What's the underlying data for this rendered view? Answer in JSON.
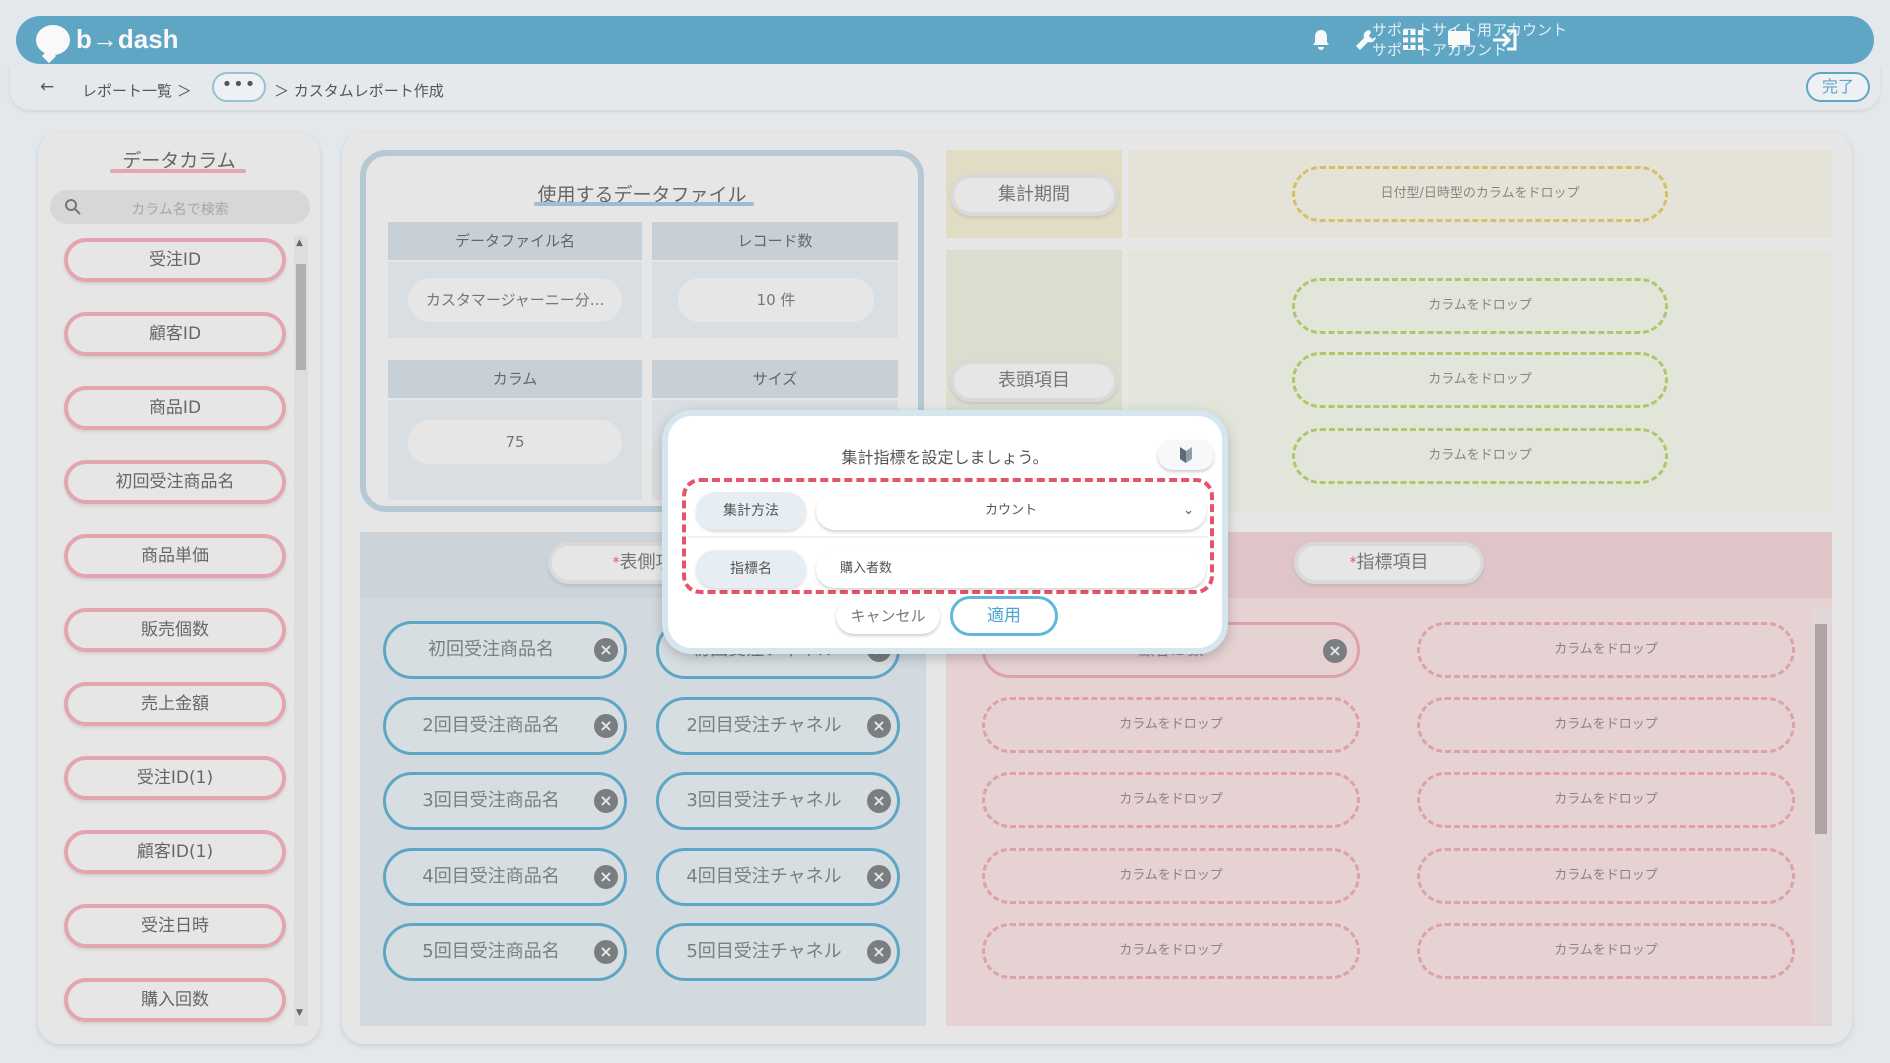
{
  "header": {
    "logo_text": "b→dash",
    "account_line1": "サポートサイト用アカウント",
    "account_line2": "サポートアカウント",
    "brand_color": "#5fa9c9"
  },
  "breadcrumb": {
    "back": "←",
    "item1": "レポート一覧 ＞",
    "more": "•••",
    "item2": "＞ カスタムレポート作成",
    "done_label": "完了"
  },
  "sidebar": {
    "title": "データカラム",
    "search_placeholder": "カラム名で検索",
    "columns": [
      "受注ID",
      "顧客ID",
      "商品ID",
      "初回受注商品名",
      "商品単価",
      "販売個数",
      "売上金額",
      "受注ID(1)",
      "顧客ID(1)",
      "受注日時",
      "購入回数"
    ]
  },
  "file": {
    "title": "使用するデータファイル",
    "name_header": "データファイル名",
    "name_value": "カスタマージャーニー分...",
    "records_header": "レコード数",
    "records_value": "10 件",
    "columns_header": "カラム",
    "columns_value": "75",
    "size_header": "サイズ"
  },
  "period": {
    "label": "集計期間",
    "drop": "日付型/日時型のカラムをドロップ"
  },
  "header_items": {
    "label": "表頭項目",
    "drops": [
      "カラムをドロップ",
      "カラムをドロップ",
      "カラムをドロップ"
    ]
  },
  "side_items": {
    "label": "表側項",
    "required_mark": "*",
    "left": [
      "初回受注商品名",
      "2回目受注商品名",
      "3回目受注商品名",
      "4回目受注商品名",
      "5回目受注商品名"
    ],
    "right": [
      "初回受注チャネル",
      "2回目受注チャネル",
      "3回目受注チャネル",
      "4回目受注チャネル",
      "5回目受注チャネル"
    ]
  },
  "metric_items": {
    "label": "指標項目",
    "required_mark": "*",
    "first_value": "顧客ID数",
    "drop": "カラムをドロップ"
  },
  "modal": {
    "title": "集計指標を設定しましょう。",
    "method_label": "集計方法",
    "method_value": "カウント",
    "name_label": "指標名",
    "name_value": "購入者数",
    "cancel_label": "キャンセル",
    "apply_label": "適用",
    "highlight_color": "#e7536b"
  }
}
